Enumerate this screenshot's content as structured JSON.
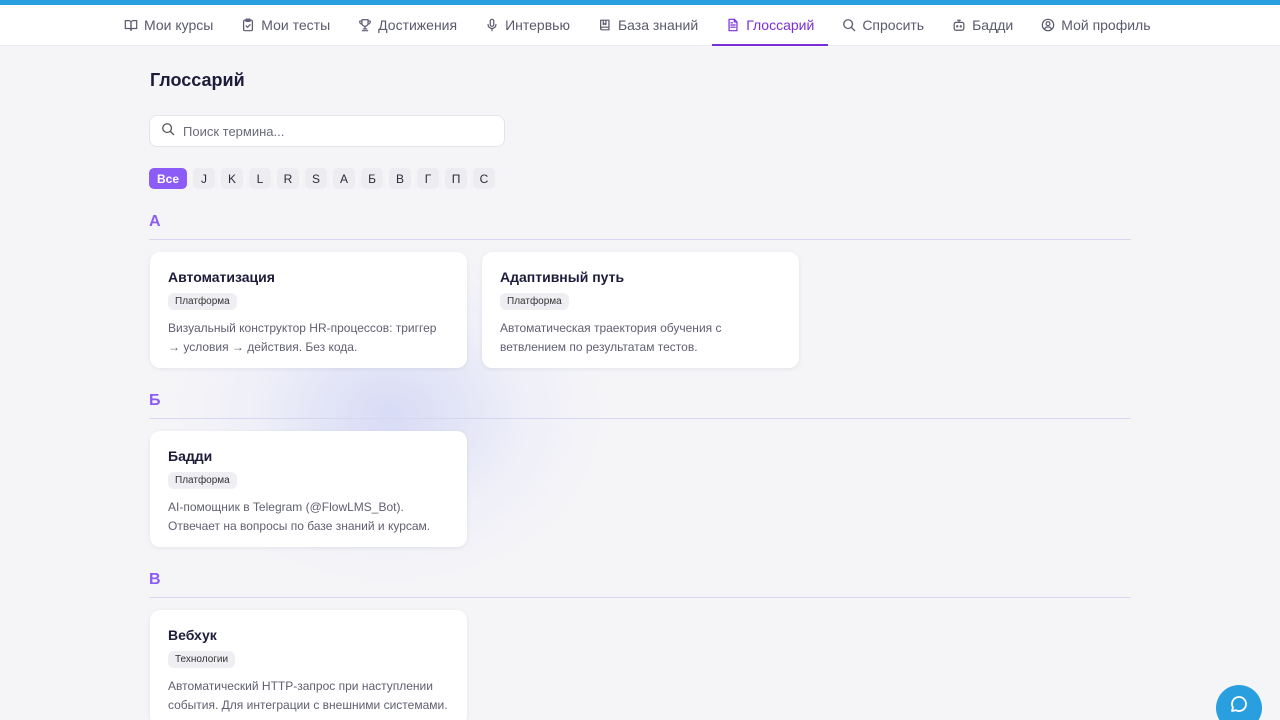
{
  "nav": {
    "items": [
      {
        "label": "Мои курсы",
        "icon": "book-open-icon",
        "active": false
      },
      {
        "label": "Мои тесты",
        "icon": "clipboard-check-icon",
        "active": false
      },
      {
        "label": "Достижения",
        "icon": "trophy-icon",
        "active": false
      },
      {
        "label": "Интервью",
        "icon": "microphone-icon",
        "active": false
      },
      {
        "label": "База знаний",
        "icon": "book-icon",
        "active": false
      },
      {
        "label": "Глоссарий",
        "icon": "file-text-icon",
        "active": true
      },
      {
        "label": "Спросить",
        "icon": "search-icon",
        "active": false
      },
      {
        "label": "Бадди",
        "icon": "bot-icon",
        "active": false
      },
      {
        "label": "Мой профиль",
        "icon": "user-circle-icon",
        "active": false
      }
    ]
  },
  "page": {
    "title": "Глоссарий"
  },
  "search": {
    "placeholder": "Поиск термина...",
    "value": ""
  },
  "letters": [
    "Все",
    "J",
    "K",
    "L",
    "R",
    "S",
    "А",
    "Б",
    "В",
    "Г",
    "П",
    "С"
  ],
  "sections": [
    {
      "letter": "А",
      "terms": [
        {
          "title": "Автоматизация",
          "tag": "Платформа",
          "description": "Визуальный конструктор HR-процессов: триггер → условия → действия. Без кода."
        },
        {
          "title": "Адаптивный путь",
          "tag": "Платформа",
          "description": "Автоматическая траектория обучения с ветвлением по результатам тестов."
        }
      ]
    },
    {
      "letter": "Б",
      "terms": [
        {
          "title": "Бадди",
          "tag": "Платформа",
          "description": "AI-помощник в Telegram (@FlowLMS_Bot). Отвечает на вопросы по базе знаний и курсам."
        }
      ]
    },
    {
      "letter": "В",
      "terms": [
        {
          "title": "Вебхук",
          "tag": "Технологии",
          "description": "Автоматический HTTP-запрос при наступлении события. Для интеграции с внешними системами."
        }
      ]
    }
  ],
  "colors": {
    "accent": "#8b5cf6",
    "nav_active": "#7a2fd6",
    "top_bar": "#2a9fe0",
    "chat_button": "#2a9fe0"
  },
  "chat": {
    "icon": "chat-bubble-icon"
  }
}
